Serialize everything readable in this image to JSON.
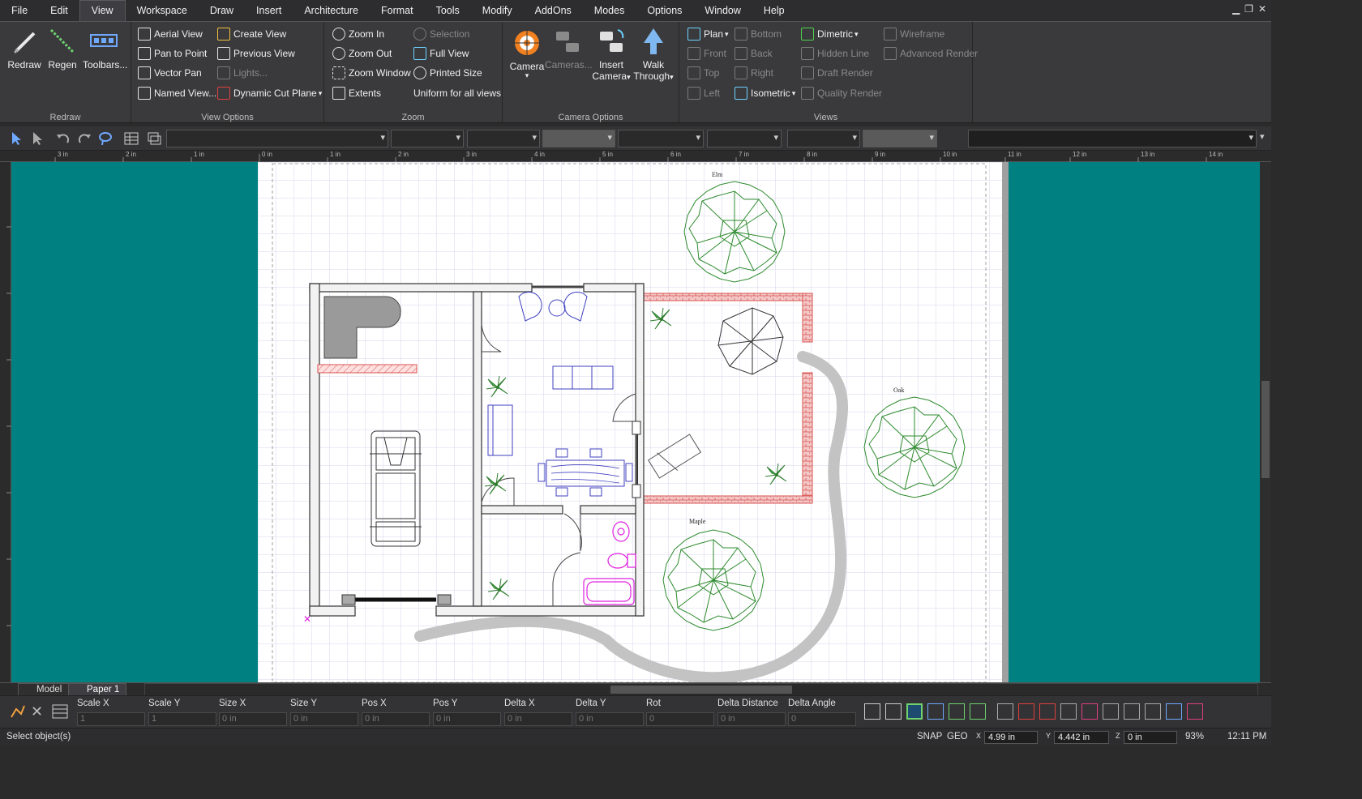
{
  "menu": [
    "File",
    "Edit",
    "View",
    "Workspace",
    "Draw",
    "Insert",
    "Architecture",
    "Format",
    "Tools",
    "Modify",
    "AddOns",
    "Modes",
    "Options",
    "Window",
    "Help"
  ],
  "menu_active": "View",
  "ribbon": {
    "redraw": {
      "label": "Redraw",
      "redraw": "Redraw",
      "regen": "Regen",
      "toolbars": "Toolbars..."
    },
    "view_options": {
      "label": "View Options",
      "aerial_view": "Aerial View",
      "pan_to_point": "Pan to Point",
      "vector_pan": "Vector Pan",
      "named_view": "Named View...",
      "create_view": "Create View",
      "previous_view": "Previous View",
      "lights": "Lights...",
      "dynamic_cut_plane": "Dynamic Cut Plane"
    },
    "zoom": {
      "label": "Zoom",
      "zoom_in": "Zoom In",
      "zoom_out": "Zoom Out",
      "zoom_window": "Zoom Window",
      "extents": "Extents",
      "selection": "Selection",
      "full_view": "Full View",
      "printed_size": "Printed Size",
      "uniform": "Uniform for all views"
    },
    "camera_options": {
      "label": "Camera Options",
      "camera": "Camera",
      "cameras": "Cameras...",
      "insert_camera_1": "Insert",
      "insert_camera_2": "Camera",
      "walk_1": "Walk",
      "walk_2": "Through"
    },
    "views": {
      "label": "Views",
      "plan": "Plan",
      "front": "Front",
      "top": "Top",
      "left": "Left",
      "bottom": "Bottom",
      "back": "Back",
      "right": "Right",
      "isometric": "Isometric",
      "dimetric": "Dimetric",
      "hidden_line": "Hidden Line",
      "draft_render": "Draft Render",
      "quality_render": "Quality Render",
      "wireframe": "Wireframe",
      "advanced_render": "Advanced Render"
    }
  },
  "ruler_labels": [
    "3 in",
    "2 in",
    "1 in",
    "0 in",
    "1 in",
    "2 in",
    "3 in",
    "4 in",
    "5 in",
    "6 in",
    "7 in",
    "8 in",
    "9 in",
    "10 in",
    "11 in",
    "12 in",
    "13 in",
    "14 in"
  ],
  "drawing_labels": {
    "elm": "Elm",
    "oak": "Oak",
    "maple": "Maple"
  },
  "tabs": {
    "model": "Model",
    "paper": "Paper 1"
  },
  "properties": {
    "scale_x": {
      "label": "Scale X",
      "value": "1"
    },
    "scale_y": {
      "label": "Scale Y",
      "value": "1"
    },
    "size_x": {
      "label": "Size X",
      "value": "0 in"
    },
    "size_y": {
      "label": "Size Y",
      "value": "0 in"
    },
    "pos_x": {
      "label": "Pos X",
      "value": "0 in"
    },
    "pos_y": {
      "label": "Pos Y",
      "value": "0 in"
    },
    "delta_x": {
      "label": "Delta X",
      "value": "0 in"
    },
    "delta_y": {
      "label": "Delta Y",
      "value": "0 in"
    },
    "rot": {
      "label": "Rot",
      "value": "0"
    },
    "delta_distance": {
      "label": "Delta Distance",
      "value": "0 in"
    },
    "delta_angle": {
      "label": "Delta Angle",
      "value": "0"
    }
  },
  "status": {
    "message": "Select object(s)",
    "snap": "SNAP",
    "geo": "GEO",
    "x": "4.99 in",
    "y": "4.442 in",
    "z": "0 in",
    "zoom": "93%",
    "time": "12:11 PM"
  },
  "colors": {
    "canvas": "#008080",
    "grid": "#d6d6ee",
    "brick": "#d9534f",
    "plant": "#2e8b2e",
    "furniture": "#4040c0",
    "fixture": "#e020e0",
    "path": "#bdbdbd"
  }
}
